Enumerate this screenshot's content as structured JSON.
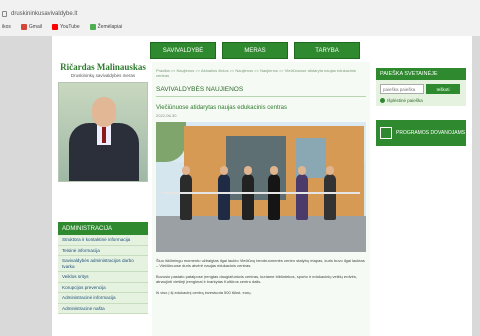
{
  "browser": {
    "url": "druskininkusavivaldybe.lt",
    "bookmarks": [
      {
        "label": "Gmail",
        "color": "#d44638"
      },
      {
        "label": "YouTube",
        "color": "#ff0000"
      },
      {
        "label": "Žemėlapiai",
        "color": "#4caf50"
      }
    ],
    "apps_label": "ikos"
  },
  "topnav": [
    "SAVIVALDYBĖ",
    "MERAS",
    "TARYBA"
  ],
  "mayor": {
    "name": "Ričardas Malinauskas",
    "title": "Druskininkų savivaldybės meras"
  },
  "administration": {
    "heading": "ADMINISTRACIJA",
    "items": [
      "Struktūra ir kontaktinė informacija",
      "Teisinė informacija",
      "Savivaldybės administracijos darbo tvarka",
      "Veiklos sritys",
      "Korupcijos prevencija",
      "Administracinė informacija",
      "Administracinė našta"
    ]
  },
  "main": {
    "breadcrumb": "Pradžia >> Naujienos >> Aktualios žinios >> Naujienos >> Naujienos >> Viečiūnuose atidaryta naujas edukacinis centras",
    "section_title": "SAVIVALDYBĖS NAUJIENOS",
    "article_title": "Viečiūnuose atidarytas naujas edukacinis centras",
    "article_date": "2022-06-30",
    "paragraphs": [
      "Šiuo iškilmingu momentu užbaigtas ilgai laukto Viečiūnų bendruomenės centro statybų etapas, kuris buvo ilgai lauktas – Viečiūnuose duris atvėrė naujas edukacinis centras.",
      "Buvusio pastato patalpose įrengtas daugiafunkcis centras, kuriame bibliotekos, sporto ir edukacinių veiklų erdvės, atnaujinti viešieji įrengimai ir tvarkytas Kultūros centro dalis.",
      "Iš viso į šį edukacinį centrą investuota 500 tūkst. eurų."
    ]
  },
  "search": {
    "heading": "PAIEŠKA SVETAINĖJE",
    "placeholder": "paieška paieška",
    "button_label": "Ieškoti",
    "advanced_label": "Išplėstinė paieška"
  },
  "program": {
    "label": "PROGRAMOS DOVANOJAMS"
  }
}
